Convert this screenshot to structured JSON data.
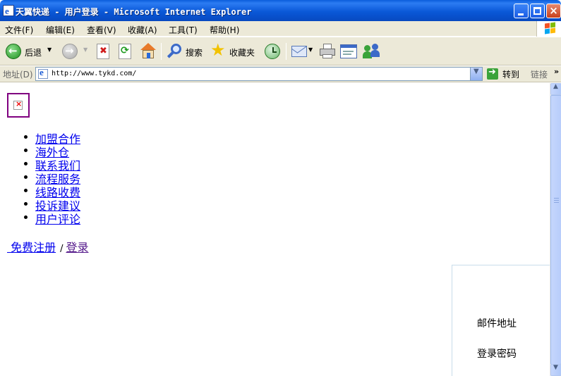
{
  "window": {
    "title": "天翼快递 - 用户登录 - Microsoft Internet Explorer"
  },
  "menu": [
    "文件(F)",
    "编辑(E)",
    "查看(V)",
    "收藏(A)",
    "工具(T)",
    "帮助(H)"
  ],
  "toolbar": {
    "back": "后退",
    "search": "搜索",
    "favorites": "收藏夹"
  },
  "address": {
    "label": "地址(D)",
    "url": "http://www.tykd.com/",
    "go": "转到",
    "links": "链接"
  },
  "page": {
    "nav_links": [
      "加盟合作",
      "海外仓",
      "联系我们",
      "流程服务",
      "线路收费",
      "投诉建议",
      "用户评论"
    ],
    "register_link": " 免费注册",
    "separator": "/",
    "login_link": "登录",
    "login_form": {
      "email_label": "邮件地址",
      "password_label": "登录密码"
    }
  },
  "colors": {
    "titlebar": "#0a58d8",
    "chrome": "#ece9d8",
    "link": "#0000ee",
    "visited_link": "#551a8b"
  }
}
